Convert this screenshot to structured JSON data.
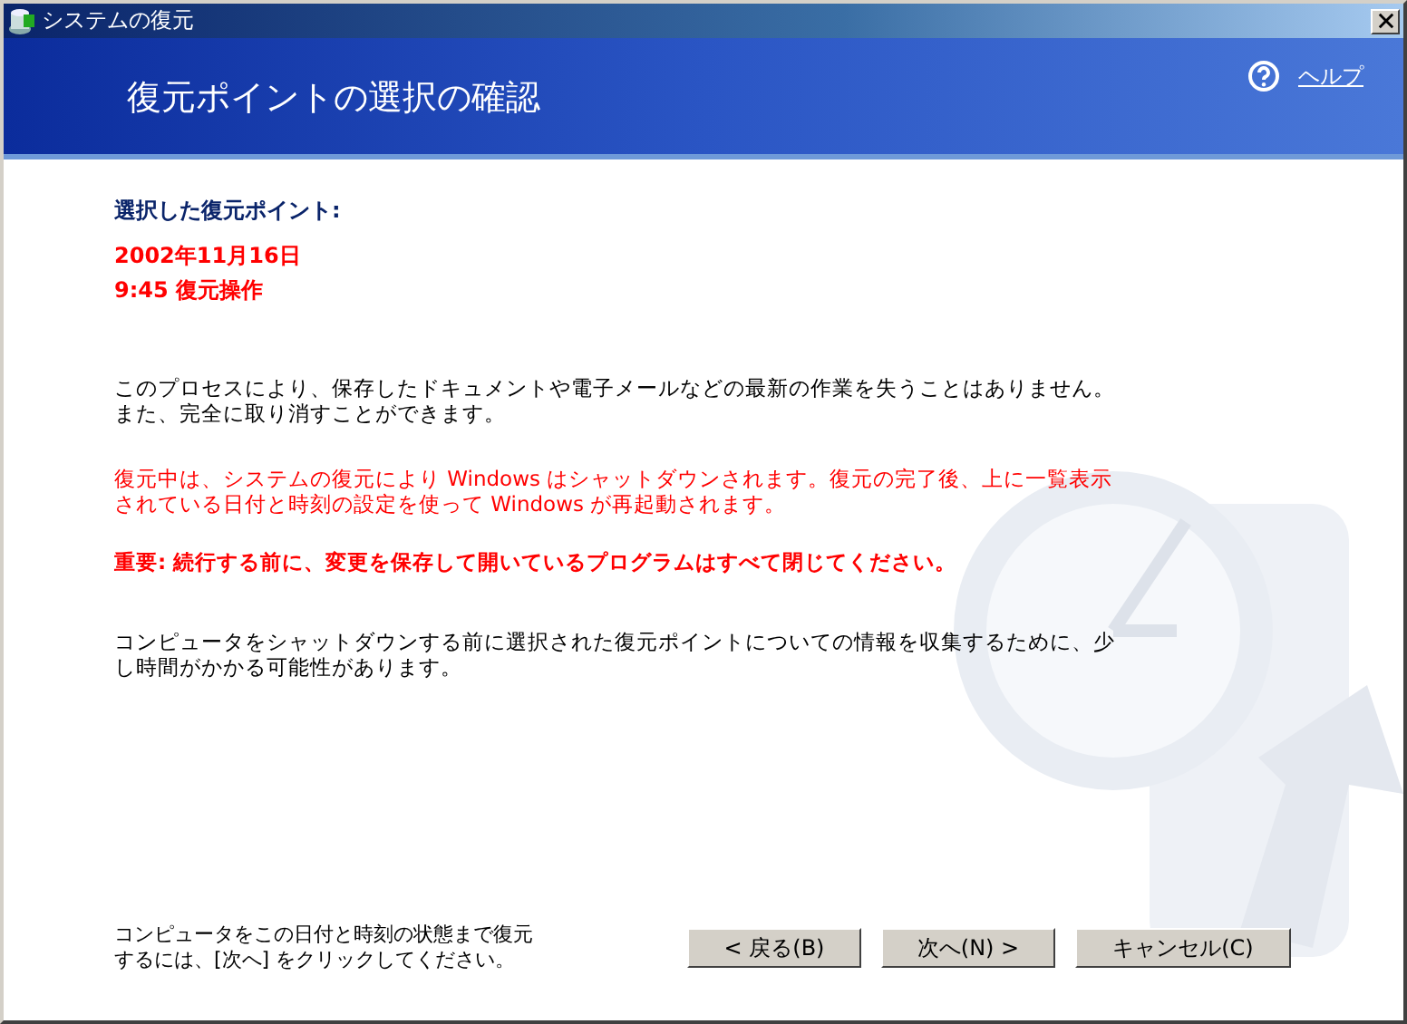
{
  "window": {
    "title": "システムの復元"
  },
  "header": {
    "title": "復元ポイントの選択の確認",
    "help": "ヘルプ"
  },
  "selected_point": {
    "label": "選択した復元ポイント:",
    "date": "2002年11月16日",
    "description": "9:45 復元操作"
  },
  "paragraphs": [
    {
      "kind": "normal",
      "text": "このプロセスにより、保存したドキュメントや電子メールなどの最新の作業を失うことはありません。また、完全に取り消すことができます。"
    },
    {
      "kind": "warning",
      "text": "復元中は、システムの復元により Windows はシャットダウンされます。復元の完了後、上に一覧表示されている日付と時刻の設定を使って Windows が再起動されます。"
    },
    {
      "kind": "important",
      "text": "重要: 続行する前に、変更を保存して開いているプログラムはすべて閉じてください。"
    },
    {
      "kind": "normal",
      "text": "コンピュータをシャットダウンする前に選択された復元ポイントについての情報を収集するために、少し時間がかかる可能性があります。"
    }
  ],
  "footer_note": "コンピュータをこの日付と時刻の状態まで復元するには、[次へ] をクリックしてください。",
  "buttons": [
    "< 戻る(B)",
    "次へ(N) >",
    "キャンセル(C)"
  ]
}
